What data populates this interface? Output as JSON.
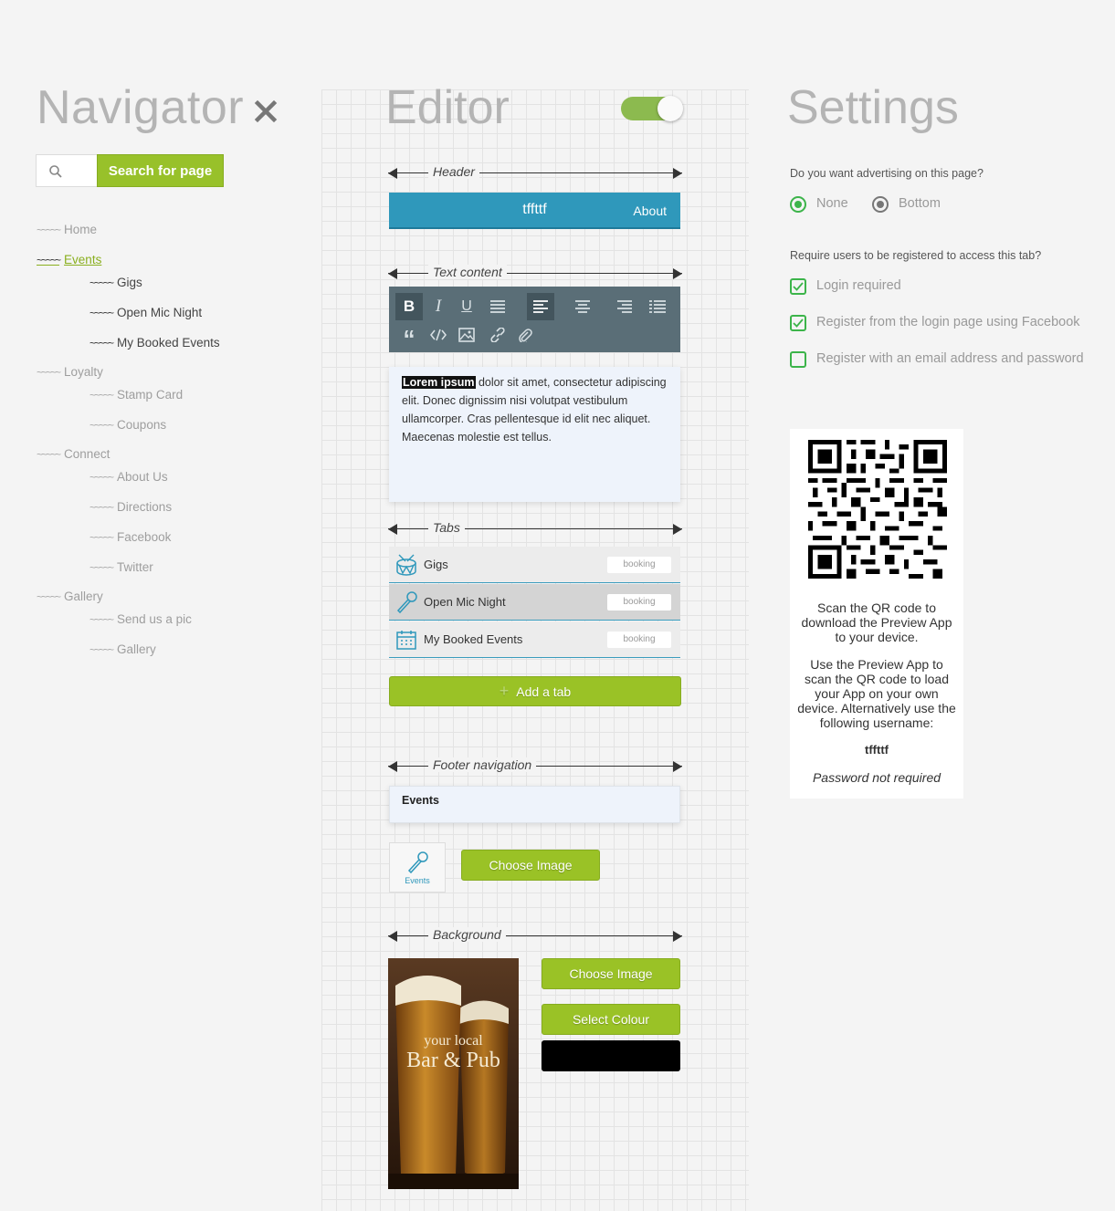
{
  "navigator": {
    "title": "Navigator",
    "search": {
      "value": "",
      "placeholder": "",
      "button_label": "Search for page"
    },
    "tree": [
      {
        "label": "Home",
        "level": 0
      },
      {
        "label": "Events",
        "level": 0,
        "active": true
      },
      {
        "label": "Gigs",
        "level": 1
      },
      {
        "label": "Open Mic Night",
        "level": 1
      },
      {
        "label": "My Booked Events",
        "level": 1
      },
      {
        "label": "Loyalty",
        "level": 0
      },
      {
        "label": "Stamp Card",
        "level": 1
      },
      {
        "label": "Coupons",
        "level": 1
      },
      {
        "label": "Connect",
        "level": 0
      },
      {
        "label": "About Us",
        "level": 1
      },
      {
        "label": "Directions",
        "level": 1
      },
      {
        "label": "Facebook",
        "level": 1
      },
      {
        "label": "Twitter",
        "level": 1
      },
      {
        "label": "Gallery",
        "level": 0
      },
      {
        "label": "Send us a pic",
        "level": 1
      },
      {
        "label": "Gallery",
        "level": 1
      }
    ]
  },
  "editor": {
    "title": "Editor",
    "toggle_on": true,
    "sections": {
      "header": "Header",
      "text_content": "Text content",
      "tabs": "Tabs",
      "footer_navigation": "Footer navigation",
      "background": "Background"
    },
    "header_bar": {
      "title": "tffttf",
      "link": "About"
    },
    "text_content": {
      "highlight": "Lorem ipsum",
      "body": " dolor sit amet, consectetur adipiscing elit. Donec dignissim nisi volutpat vestibulum ullamcorper. Cras pellentesque id elit nec aliquet. Maecenas molestie est tellus."
    },
    "toolbar_icons": [
      "bold-icon",
      "italic-icon",
      "underline-icon",
      "justify-icon",
      "align-left-icon",
      "align-center-icon",
      "align-right-icon",
      "list-icon",
      "quote-icon",
      "code-icon",
      "image-icon",
      "link-icon",
      "attachment-icon"
    ],
    "tabs": [
      {
        "label": "Gigs",
        "badge": "booking",
        "icon": "drum-icon"
      },
      {
        "label": "Open Mic Night",
        "badge": "booking",
        "icon": "microphone-icon"
      },
      {
        "label": "My Booked Events",
        "badge": "booking",
        "icon": "calendar-icon"
      }
    ],
    "add_tab_label": "Add a tab",
    "footer": {
      "item_label": "Events",
      "icon_caption": "Events",
      "choose_image_label": "Choose Image"
    },
    "background": {
      "choose_image_label": "Choose Image",
      "select_colour_label": "Select Colour",
      "colour": "#000000",
      "preview_line1": "your local",
      "preview_line2": "Bar & Pub"
    }
  },
  "settings": {
    "title": "Settings",
    "advertising_question": "Do you want advertising on this page?",
    "advertising_options": [
      {
        "label": "None",
        "selected": true
      },
      {
        "label": "Bottom",
        "selected": false
      }
    ],
    "registration_question": "Require users to be registered to access this tab?",
    "registration_options": [
      {
        "label": "Login required",
        "checked": true
      },
      {
        "label": "Register from the login page using Facebook",
        "checked": true
      },
      {
        "label": "Register with an email address and password",
        "checked": false
      }
    ],
    "qr": {
      "text1": "Scan the QR code to download the Preview App to your device.",
      "text2": "Use the Preview App to scan the QR code to load your App on your own device. Alternatively use the following username:",
      "username": "tffttf",
      "note": "Password not required"
    }
  },
  "colors": {
    "accent_green": "#98c12a",
    "header_blue": "#2f98bb",
    "toolbar_slate": "#5a6e77",
    "check_green": "#3cb44a"
  }
}
